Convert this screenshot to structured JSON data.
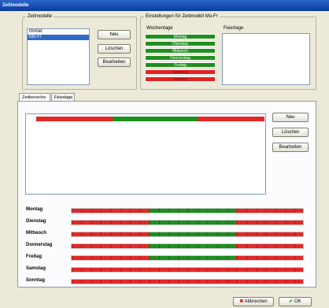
{
  "window": {
    "title": "Zeitmodelle"
  },
  "zeitmodelle": {
    "legend": "Zeitmodelle",
    "items": [
      "Immer",
      "Mo-Fr"
    ],
    "selected_index": 1,
    "buttons": {
      "neu": "Neu",
      "loeschen": "Löschen",
      "bearbeiten": "Bearbeiten"
    }
  },
  "einstellungen": {
    "legend": "Einstellungen für Zeitmodell Mo-Fr",
    "wochentage_label": "Wochentage",
    "feiertage_label": "Feiertage",
    "days": [
      {
        "label": "Montag",
        "status": "active"
      },
      {
        "label": "Dienstag",
        "status": "active"
      },
      {
        "label": "Mittwoch",
        "status": "active"
      },
      {
        "label": "Donnerstag",
        "status": "active"
      },
      {
        "label": "Freitag",
        "status": "active"
      },
      {
        "label": "Samstag",
        "status": "inactive"
      },
      {
        "label": "Sonntag",
        "status": "inactive"
      }
    ]
  },
  "tabs": [
    {
      "label": "Zeitbereiche",
      "active": true
    },
    {
      "label": "Feiertage",
      "active": false
    }
  ],
  "zeitbereiche": {
    "buttons": {
      "neu": "Neu",
      "loeschen": "Löschen",
      "bearbeiten": "Bearbeiten"
    },
    "editor_segments": [
      {
        "from": 0,
        "to": 8,
        "state": "off"
      },
      {
        "from": 8,
        "to": 17,
        "state": "on"
      },
      {
        "from": 17,
        "to": 24,
        "state": "off"
      }
    ]
  },
  "schedule": {
    "colors": {
      "on": "#1f8f1f",
      "off": "#e52727"
    },
    "rows": [
      {
        "day": "Montag",
        "on_from": 8,
        "on_to": 17
      },
      {
        "day": "Dienstag",
        "on_from": 8,
        "on_to": 17
      },
      {
        "day": "Mittwoch",
        "on_from": 8,
        "on_to": 17
      },
      {
        "day": "Donnerstag",
        "on_from": 8,
        "on_to": 17
      },
      {
        "day": "Freitag",
        "on_from": 8,
        "on_to": 17
      },
      {
        "day": "Samstag",
        "on_from": null,
        "on_to": null
      },
      {
        "day": "Sonntag",
        "on_from": null,
        "on_to": null
      }
    ]
  },
  "footer": {
    "cancel": "Abbrechen",
    "ok": "OK"
  }
}
